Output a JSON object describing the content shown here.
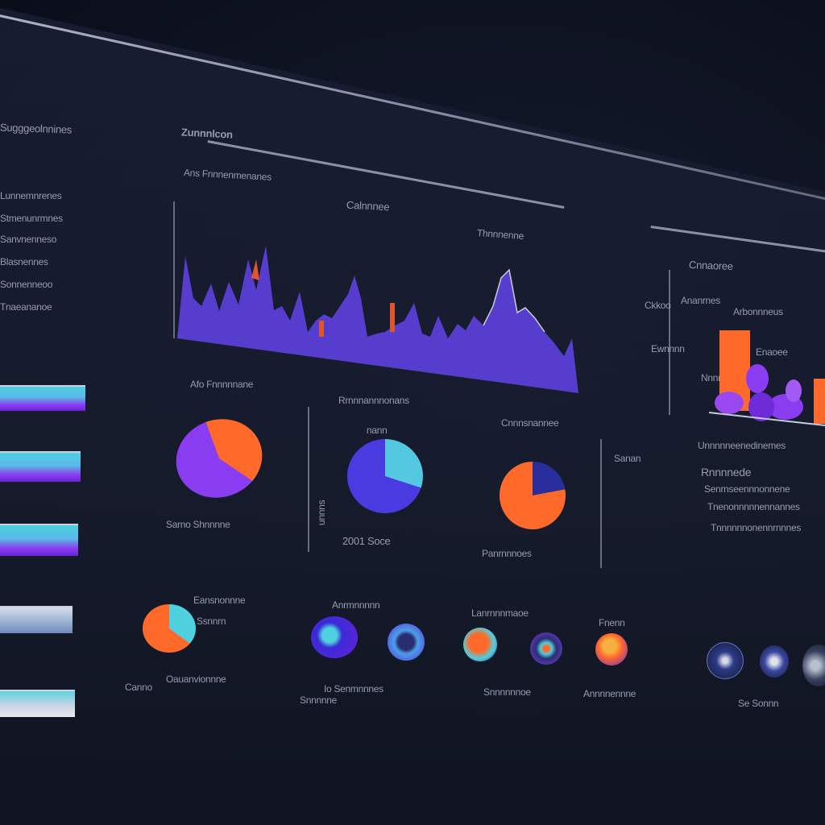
{
  "sidebar": {
    "title": "Sugggeolnnines",
    "items": [
      "Lunnemnrenes",
      "Stmenunrmnes",
      "Sanvnenneso",
      "Blasnennes",
      "Sonnenneoo",
      "Tnaeananoe"
    ]
  },
  "main": {
    "header": "Zunnnlcon",
    "subheader": "Ans Fnnnenmenanes"
  },
  "area_chart": {
    "title": "Calnnnee",
    "sublabel": "Thnnnenne",
    "colors": {
      "fill": "#5a3fd8",
      "accent": "#e0552a"
    }
  },
  "bar_panel": {
    "title": "Cnnaoree",
    "axis_labels": [
      "Ckkoo",
      "Ananrnes",
      "Arbonnneus",
      "Ewnnnn",
      "Enaoee",
      "Nnnn"
    ],
    "colors": {
      "orange": "#ff6a2b",
      "purple": "#8a3df0"
    }
  },
  "pies": {
    "pie1": {
      "title": "Afo Fnnnnnane",
      "caption": "Sarno Shnnnne"
    },
    "pie2": {
      "title": "Rrnnnannnonans",
      "label_top": "nann",
      "caption": "2001 Soce",
      "side_caption": "unnns"
    },
    "pie3": {
      "title": "Cnnnsnannee",
      "caption": "Panrnnnoes",
      "side_label": "Sanan"
    }
  },
  "text_block": [
    "Unnnnneenedinemes",
    "Rnnnnede",
    "Senrnseennnonnene",
    "Tnenonnnnnennannes",
    "Tnnnnnnonennrnnnes"
  ],
  "bottom": {
    "left_title": "Eansnonnne",
    "left_badge": "Ssnnrn",
    "left_caption": "Oauanvionnne",
    "left_sub": "Canno",
    "row_title": "Anrmnnnnn",
    "row_title2": "Lanrnnnmaoe",
    "row_title3": "Fnenn",
    "row_caption1": "Io Senmnnnes",
    "row_caption2": "Snnnnnnoe",
    "row_caption3": "Annnnennne",
    "row_caption_sub": "Snnnnne",
    "right_caption": "Se Sonnn"
  }
}
